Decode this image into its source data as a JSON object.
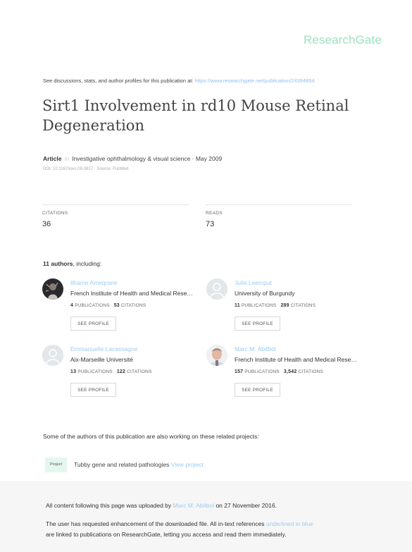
{
  "brand": {
    "logo": "ResearchGate"
  },
  "header": {
    "discuss_text": "See discussions, stats, and author profiles for this publication at: ",
    "discuss_url": "https://www.researchgate.net/publication/24394854"
  },
  "paper": {
    "title": "Sirt1 Involvement in rd10 Mouse Retinal Degeneration",
    "type": "Article",
    "sep": "in",
    "journal": "Investigative ophthalmology & visual science · May 2009",
    "doi": "DOI: 10.1167/iovs.09-3817 · Source: PubMed"
  },
  "stats": {
    "citations_label": "CITATIONS",
    "citations_value": "36",
    "reads_label": "READS",
    "reads_value": "73"
  },
  "authors_section": {
    "count": "11 authors",
    "suffix": ", including:"
  },
  "authors": [
    {
      "name": "Ilhame Ameqrane",
      "institution": "French Institute of Health and Medical Rese…",
      "publications": "4",
      "citations": "53",
      "pub_label": "PUBLICATIONS",
      "cit_label": "CITATIONS",
      "button": "SEE PROFILE",
      "avatar": "photo-dark"
    },
    {
      "name": "Julia Leemput",
      "institution": "University of Burgundy",
      "publications": "11",
      "citations": "289",
      "pub_label": "PUBLICATIONS",
      "cit_label": "CITATIONS",
      "button": "SEE PROFILE",
      "avatar": "placeholder"
    },
    {
      "name": "Emmanuelle Lacassagne",
      "institution": "Aix-Marseille Université",
      "publications": "13",
      "citations": "122",
      "pub_label": "PUBLICATIONS",
      "cit_label": "CITATIONS",
      "button": "SEE PROFILE",
      "avatar": "placeholder"
    },
    {
      "name": "Marc M. Abitbol",
      "institution": "French Institute of Health and Medical Rese…",
      "publications": "157",
      "citations": "3,542",
      "pub_label": "PUBLICATIONS",
      "cit_label": "CITATIONS",
      "button": "SEE PROFILE",
      "avatar": "photo-face"
    }
  ],
  "related": {
    "heading": "Some of the authors of this publication are also working on these related projects:",
    "badge": "Project",
    "project_name": "Tubby gene and related pathologies ",
    "project_link": "View project"
  },
  "footer": {
    "line1_pre": "All content following this page was uploaded by ",
    "line1_user": "Marc M. Abitbol",
    "line1_post": " on 27 November 2016.",
    "line2_pre": "The user has requested enhancement of the downloaded file. All in-text references ",
    "line2_link": "underlined in blue",
    "line3": "are linked to publications on ResearchGate, letting you access and read them immediately."
  },
  "colors": {
    "brand": "#9ee0c3",
    "link": "#9ccbf0",
    "footer_bg": "#f6f6f6"
  }
}
